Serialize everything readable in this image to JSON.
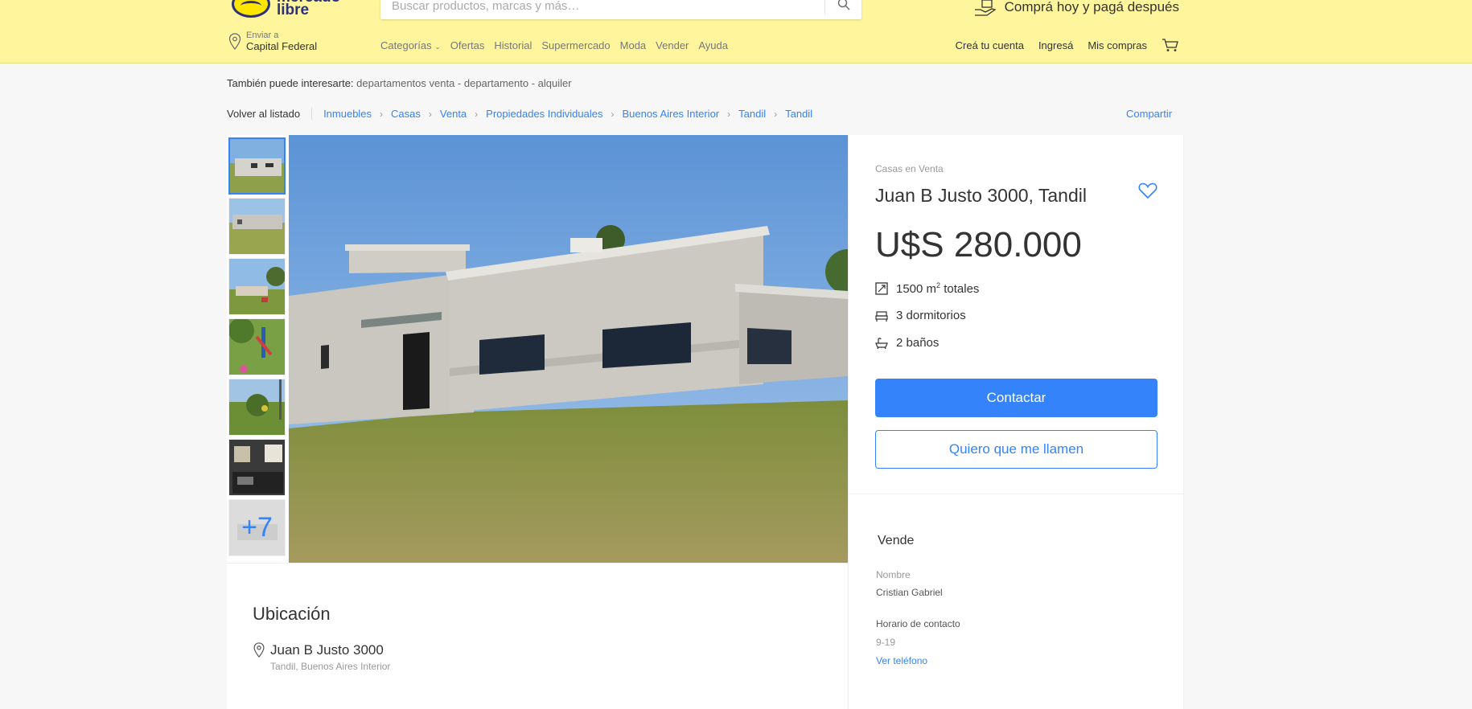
{
  "header": {
    "logo_text_line1": "mercado",
    "logo_text_line2": "libre",
    "search_placeholder": "Buscar productos, marcas y más…",
    "promo_text": "Comprá hoy y pagá después",
    "ship_small": "Enviar a",
    "ship_location": "Capital Federal",
    "nav": [
      "Categorías",
      "Ofertas",
      "Historial",
      "Supermercado",
      "Moda",
      "Vender",
      "Ayuda"
    ],
    "nav_right": [
      "Creá tu cuenta",
      "Ingresá",
      "Mis compras"
    ],
    "brand_color": "#fff59d"
  },
  "related": {
    "label": "También puede interesarte:",
    "links": "departamentos venta - departamento - alquiler"
  },
  "breadcrumb": {
    "back": "Volver al listado",
    "items": [
      "Inmuebles",
      "Casas",
      "Venta",
      "Propiedades Individuales",
      "Buenos Aires Interior",
      "Tandil",
      "Tandil"
    ],
    "share": "Compartir"
  },
  "gallery": {
    "more_count": "+7"
  },
  "listing": {
    "category": "Casas en Venta",
    "title": "Juan B Justo 3000, Tandil",
    "price": "U$S 280.000",
    "area_value": "1500 m",
    "area_sup": "2",
    "area_suffix": " totales",
    "bedrooms": "3 dormitorios",
    "bathrooms": "2 baños",
    "contact_button": "Contactar",
    "callback_button": "Quiero que me llamen",
    "accent_color": "#3483fa"
  },
  "seller": {
    "title": "Vende",
    "name_label": "Nombre",
    "name": "Cristian Gabriel",
    "hours_label": "Horario de contacto",
    "hours": "9-19",
    "phone_link": "Ver teléfono"
  },
  "location": {
    "title": "Ubicación",
    "address": "Juan B Justo 3000",
    "region": "Tandil, Buenos Aires Interior"
  }
}
